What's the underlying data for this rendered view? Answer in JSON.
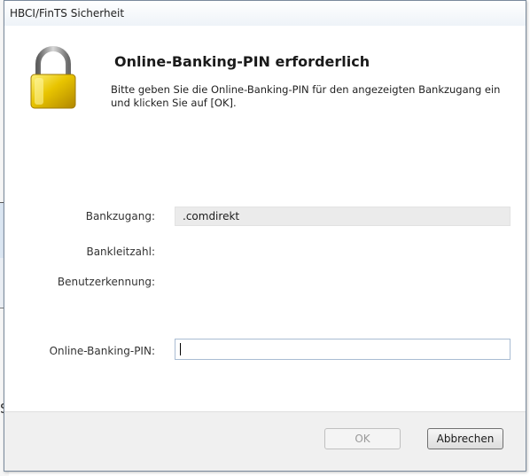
{
  "background_window": {
    "partial_text": "Si"
  },
  "dialog": {
    "title": "HBCI/FinTS Sicherheit",
    "heading": "Online-Banking-PIN erforderlich",
    "description": "Bitte geben Sie die Online-Banking-PIN für den angezeigten Bankzugang ein und klicken Sie auf [OK].",
    "icon": "padlock-icon",
    "fields": {
      "bankzugang": {
        "label": "Bankzugang:",
        "value": ".comdirekt"
      },
      "bankleitzahl": {
        "label": "Bankleitzahl:",
        "value": ""
      },
      "benutzerkennung": {
        "label": "Benutzerkennung:",
        "value": ""
      },
      "pin": {
        "label": "Online-Banking-PIN:",
        "value": ""
      }
    },
    "buttons": {
      "ok": {
        "label": "OK",
        "enabled": false
      },
      "cancel": {
        "label": "Abbrechen",
        "enabled": true
      }
    }
  },
  "colors": {
    "lock_gold": "#d9b000",
    "lock_shackle": "#8c8c8c",
    "readonly_bg": "#ebebeb",
    "footer_bg": "#f0f0f0",
    "input_border": "#a9bcd3"
  }
}
